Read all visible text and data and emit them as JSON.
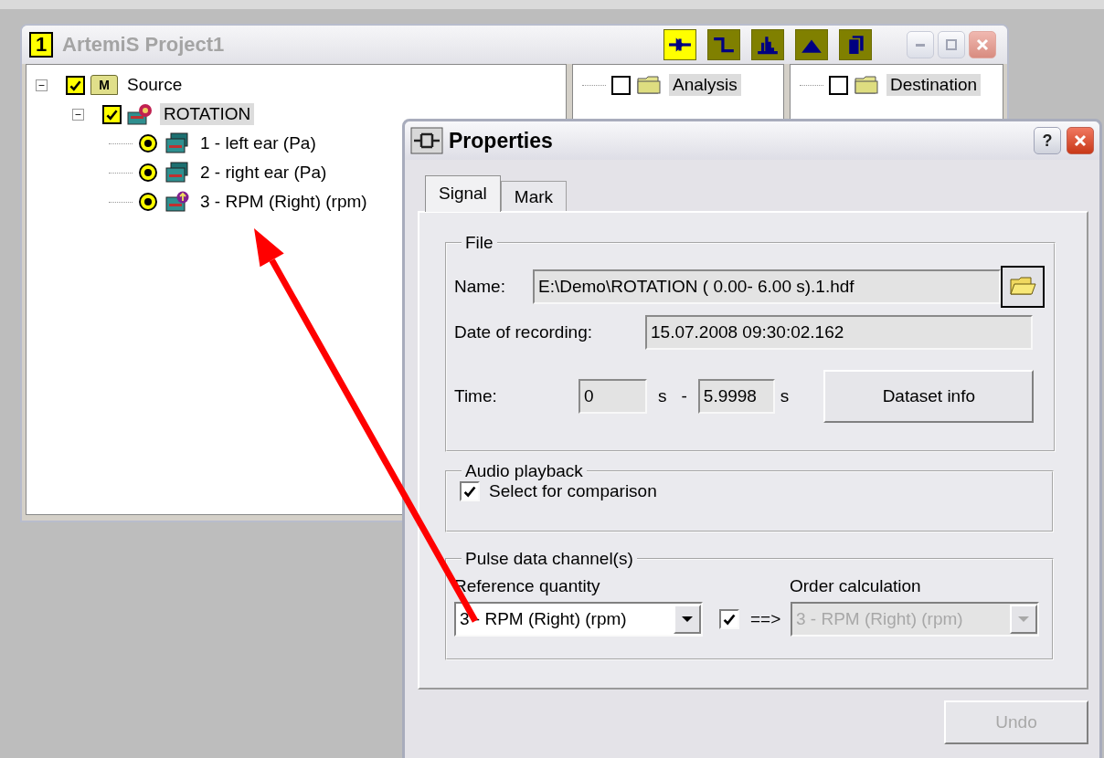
{
  "project_window": {
    "badge": "1",
    "title": "ArtemiS Project1",
    "active": false,
    "toolbar": [
      {
        "kind": "pulse",
        "selected": true
      },
      {
        "kind": "step",
        "selected": false
      },
      {
        "kind": "spectrum",
        "selected": false
      },
      {
        "kind": "peak",
        "selected": false
      },
      {
        "kind": "pages",
        "selected": false
      }
    ],
    "panes": [
      {
        "nodes": [
          {
            "label": "Source",
            "kind": "meter",
            "badge": "M",
            "checked": true,
            "expanded": true,
            "selected": false,
            "children": [
              {
                "label": "ROTATION",
                "kind": "recording",
                "checked": true,
                "expanded": true,
                "selected": true,
                "children": [
                  {
                    "label": "1 - left ear (Pa)",
                    "kind": "signal",
                    "selected": false
                  },
                  {
                    "label": "2 - right ear (Pa)",
                    "kind": "signal",
                    "selected": false
                  },
                  {
                    "label": "3 - RPM (Right) (rpm)",
                    "kind": "pulse",
                    "selected": false
                  }
                ]
              }
            ]
          }
        ]
      },
      {
        "nodes": [
          {
            "label": "Analysis",
            "kind": "folder",
            "checked": false,
            "selected": true
          }
        ]
      },
      {
        "nodes": [
          {
            "label": "Destination",
            "kind": "folder",
            "checked": false,
            "selected": true
          }
        ]
      }
    ]
  },
  "properties": {
    "title": "Properties",
    "help_label": "?",
    "tabs": [
      {
        "label": "Signal",
        "selected": true
      },
      {
        "label": "Mark",
        "selected": false
      }
    ],
    "file": {
      "legend": "File",
      "name_label": "Name:",
      "name_value": "E:\\Demo\\ROTATION ( 0.00- 6.00 s).1.hdf",
      "date_label": "Date of recording:",
      "date_value": "15.07.2008 09:30:02.162",
      "time_label": "Time:",
      "time_from": "0",
      "time_from_unit": "s",
      "time_separator": "-",
      "time_to": "5.9998",
      "time_to_unit": "s",
      "dataset_button": "Dataset info"
    },
    "audio": {
      "legend": "Audio playback",
      "checkbox": {
        "label": "Select for comparison",
        "checked": true
      }
    },
    "pulse": {
      "legend": "Pulse data channel(s)",
      "reference_label": "Reference quantity",
      "reference_value": "3 - RPM (Right) (rpm)",
      "link_checked": true,
      "link_arrow": "==>",
      "order_label": "Order calculation",
      "order_value": "3 - RPM (Right) (rpm)",
      "order_disabled": true
    },
    "undo": {
      "label": "Undo",
      "disabled": true
    }
  }
}
